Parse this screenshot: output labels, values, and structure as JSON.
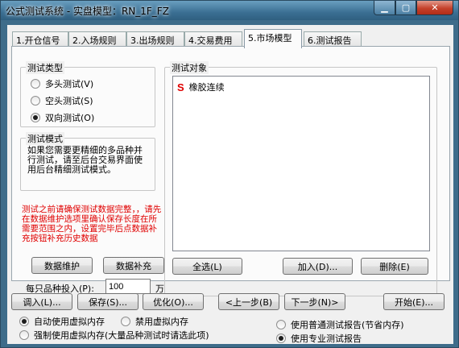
{
  "window": {
    "title": "公式测试系统 - 实盘模型：RN_1F_FZ",
    "controls": {
      "min": "▁",
      "max": "▢",
      "close": "✕"
    }
  },
  "tabs": [
    {
      "label": "1.开仓信号"
    },
    {
      "label": "2.入场规则"
    },
    {
      "label": "3.出场规则"
    },
    {
      "label": "4.交易费用"
    },
    {
      "label": "5.市场模型"
    },
    {
      "label": "6.测试报告"
    }
  ],
  "test_type": {
    "legend": "测试类型",
    "options": [
      {
        "label": "多头测试(V)",
        "selected": false
      },
      {
        "label": "空头测试(S)",
        "selected": false
      },
      {
        "label": "双向测试(O)",
        "selected": true
      }
    ]
  },
  "test_mode": {
    "legend": "测试模式",
    "text": "如果您需要更精细的多品种并行测试，请至后台交易界面使用后台精细测试模式。"
  },
  "warning": "测试之前请确保测试数据完整，，请先在数据维护选项里确认保存长度在所需要范围之内，设置完毕后点数据补充按钮补充历史数据",
  "buttons_left": {
    "maintain": "数据维护",
    "supplement": "数据补充"
  },
  "invest": {
    "label": "每只品种投入(P):",
    "value": "100",
    "unit": "万"
  },
  "test_objects": {
    "legend": "测试对象",
    "items": [
      {
        "icon": "S",
        "name": "橡胶连续"
      }
    ],
    "select_all": "全选(L)",
    "add": "加入(D)...",
    "remove": "删除(E)"
  },
  "bottom_buttons": {
    "load": "调入(L)...",
    "save": "保存(S)...",
    "optimize": "优化(O)...",
    "prev": "<上一步(B)",
    "next": "下一步(N)>",
    "start": "开始(E)..."
  },
  "memory_options": [
    {
      "label": "自动使用虚拟内存",
      "selected": true
    },
    {
      "label": "禁用虚拟内存",
      "selected": false
    },
    {
      "label": "强制使用虚拟内存(大量品种测试时请选此项)",
      "selected": false
    }
  ],
  "report_options": [
    {
      "label": "使用普通测试报告(节省内存)",
      "selected": false
    },
    {
      "label": "使用专业测试报告",
      "selected": true
    }
  ],
  "colors": {
    "warning": "#e00000",
    "title_bar": "#3e6c8a",
    "s_icon": "#e00000"
  }
}
